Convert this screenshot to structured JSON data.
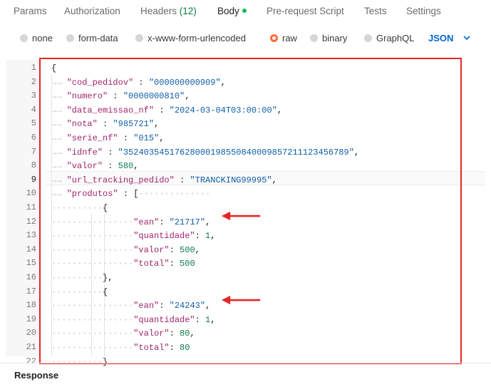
{
  "tabs": {
    "params": "Params",
    "authorization": "Authorization",
    "headers": "Headers",
    "headers_count": "(12)",
    "body": "Body",
    "pre_request": "Pre-request Script",
    "tests": "Tests",
    "settings": "Settings"
  },
  "body_modes": {
    "none": "none",
    "form_data": "form-data",
    "urlencoded": "x-www-form-urlencoded",
    "raw": "raw",
    "binary": "binary",
    "graphql": "GraphQL",
    "selected": "raw",
    "format": "JSON"
  },
  "editor": {
    "line_numbers": [
      "1",
      "2",
      "3",
      "4",
      "5",
      "6",
      "7",
      "8",
      "9",
      "10",
      "11",
      "12",
      "13",
      "14",
      "15",
      "16",
      "17",
      "18",
      "19",
      "20",
      "21",
      "22"
    ],
    "current_line": "9",
    "lines": [
      {
        "ws": "",
        "parts": [
          [
            "p",
            "{"
          ]
        ]
      },
      {
        "ws": "→→ ",
        "parts": [
          [
            "k",
            "\"cod_pedidov\""
          ],
          [
            "p",
            " : "
          ],
          [
            "s",
            "\"000000000909\""
          ],
          [
            "p",
            ","
          ]
        ]
      },
      {
        "ws": "→→ ",
        "parts": [
          [
            "k",
            "\"numero\""
          ],
          [
            "p",
            " : "
          ],
          [
            "s",
            "\"0000000810\""
          ],
          [
            "p",
            ","
          ]
        ]
      },
      {
        "ws": "→→ ",
        "parts": [
          [
            "k",
            "\"data_emissao_nf\""
          ],
          [
            "p",
            " : "
          ],
          [
            "s",
            "\"2024-03-04T03:00:00\""
          ],
          [
            "p",
            ","
          ]
        ]
      },
      {
        "ws": "→→ ",
        "parts": [
          [
            "k",
            "\"nota\""
          ],
          [
            "p",
            " : "
          ],
          [
            "s",
            "\"985721\""
          ],
          [
            "p",
            ","
          ]
        ]
      },
      {
        "ws": "→→ ",
        "parts": [
          [
            "k",
            "\"serie_nf\""
          ],
          [
            "p",
            " : "
          ],
          [
            "s",
            "\"015\""
          ],
          [
            "p",
            ","
          ]
        ]
      },
      {
        "ws": "→→ ",
        "parts": [
          [
            "k",
            "\"idnfe\""
          ],
          [
            "p",
            " : "
          ],
          [
            "s",
            "\"35240354517628000198550840009857211123456789\""
          ],
          [
            "p",
            ","
          ]
        ]
      },
      {
        "ws": "→→ ",
        "parts": [
          [
            "k",
            "\"valor\""
          ],
          [
            "p",
            " : "
          ],
          [
            "n",
            "580"
          ],
          [
            "p",
            ","
          ]
        ]
      },
      {
        "ws": "→→ ",
        "parts": [
          [
            "k",
            "\"url_tracking_pedido\""
          ],
          [
            "p",
            " : "
          ],
          [
            "s",
            "\"TRANCKING99995\""
          ],
          [
            "p",
            ","
          ]
        ]
      },
      {
        "ws": "→→ ",
        "parts": [
          [
            "k",
            "\"produtos\""
          ],
          [
            "p",
            " : "
          ],
          [
            "p",
            "["
          ],
          [
            "ws",
            "··············"
          ]
        ]
      },
      {
        "ws": "··········",
        "parts": [
          [
            "p",
            "{"
          ]
        ]
      },
      {
        "ws": "················",
        "parts": [
          [
            "k",
            "\"ean\""
          ],
          [
            "p",
            ": "
          ],
          [
            "s",
            "\"21717\""
          ],
          [
            "p",
            ","
          ]
        ]
      },
      {
        "ws": "················",
        "parts": [
          [
            "k",
            "\"quantidade\""
          ],
          [
            "p",
            ": "
          ],
          [
            "n",
            "1"
          ],
          [
            "p",
            ","
          ]
        ]
      },
      {
        "ws": "················",
        "parts": [
          [
            "k",
            "\"valor\""
          ],
          [
            "p",
            ": "
          ],
          [
            "n",
            "500"
          ],
          [
            "p",
            ","
          ]
        ]
      },
      {
        "ws": "················",
        "parts": [
          [
            "k",
            "\"total\""
          ],
          [
            "p",
            ": "
          ],
          [
            "n",
            "500"
          ]
        ]
      },
      {
        "ws": "··········",
        "parts": [
          [
            "p",
            "},"
          ]
        ]
      },
      {
        "ws": "··········",
        "parts": [
          [
            "p",
            "{"
          ]
        ]
      },
      {
        "ws": "················",
        "parts": [
          [
            "k",
            "\"ean\""
          ],
          [
            "p",
            ": "
          ],
          [
            "s",
            "\"24243\""
          ],
          [
            "p",
            ","
          ]
        ]
      },
      {
        "ws": "················",
        "parts": [
          [
            "k",
            "\"quantidade\""
          ],
          [
            "p",
            ": "
          ],
          [
            "n",
            "1"
          ],
          [
            "p",
            ","
          ]
        ]
      },
      {
        "ws": "················",
        "parts": [
          [
            "k",
            "\"valor\""
          ],
          [
            "p",
            ": "
          ],
          [
            "n",
            "80"
          ],
          [
            "p",
            ","
          ]
        ]
      },
      {
        "ws": "················",
        "parts": [
          [
            "k",
            "\"total\""
          ],
          [
            "p",
            ": "
          ],
          [
            "n",
            "80"
          ]
        ]
      },
      {
        "ws": "··········",
        "parts": [
          [
            "p",
            "}"
          ]
        ]
      }
    ]
  },
  "colors": {
    "annotation": "#e52626",
    "accent": "#ff6c37",
    "format": "#0265d2"
  },
  "response_label": "Response"
}
